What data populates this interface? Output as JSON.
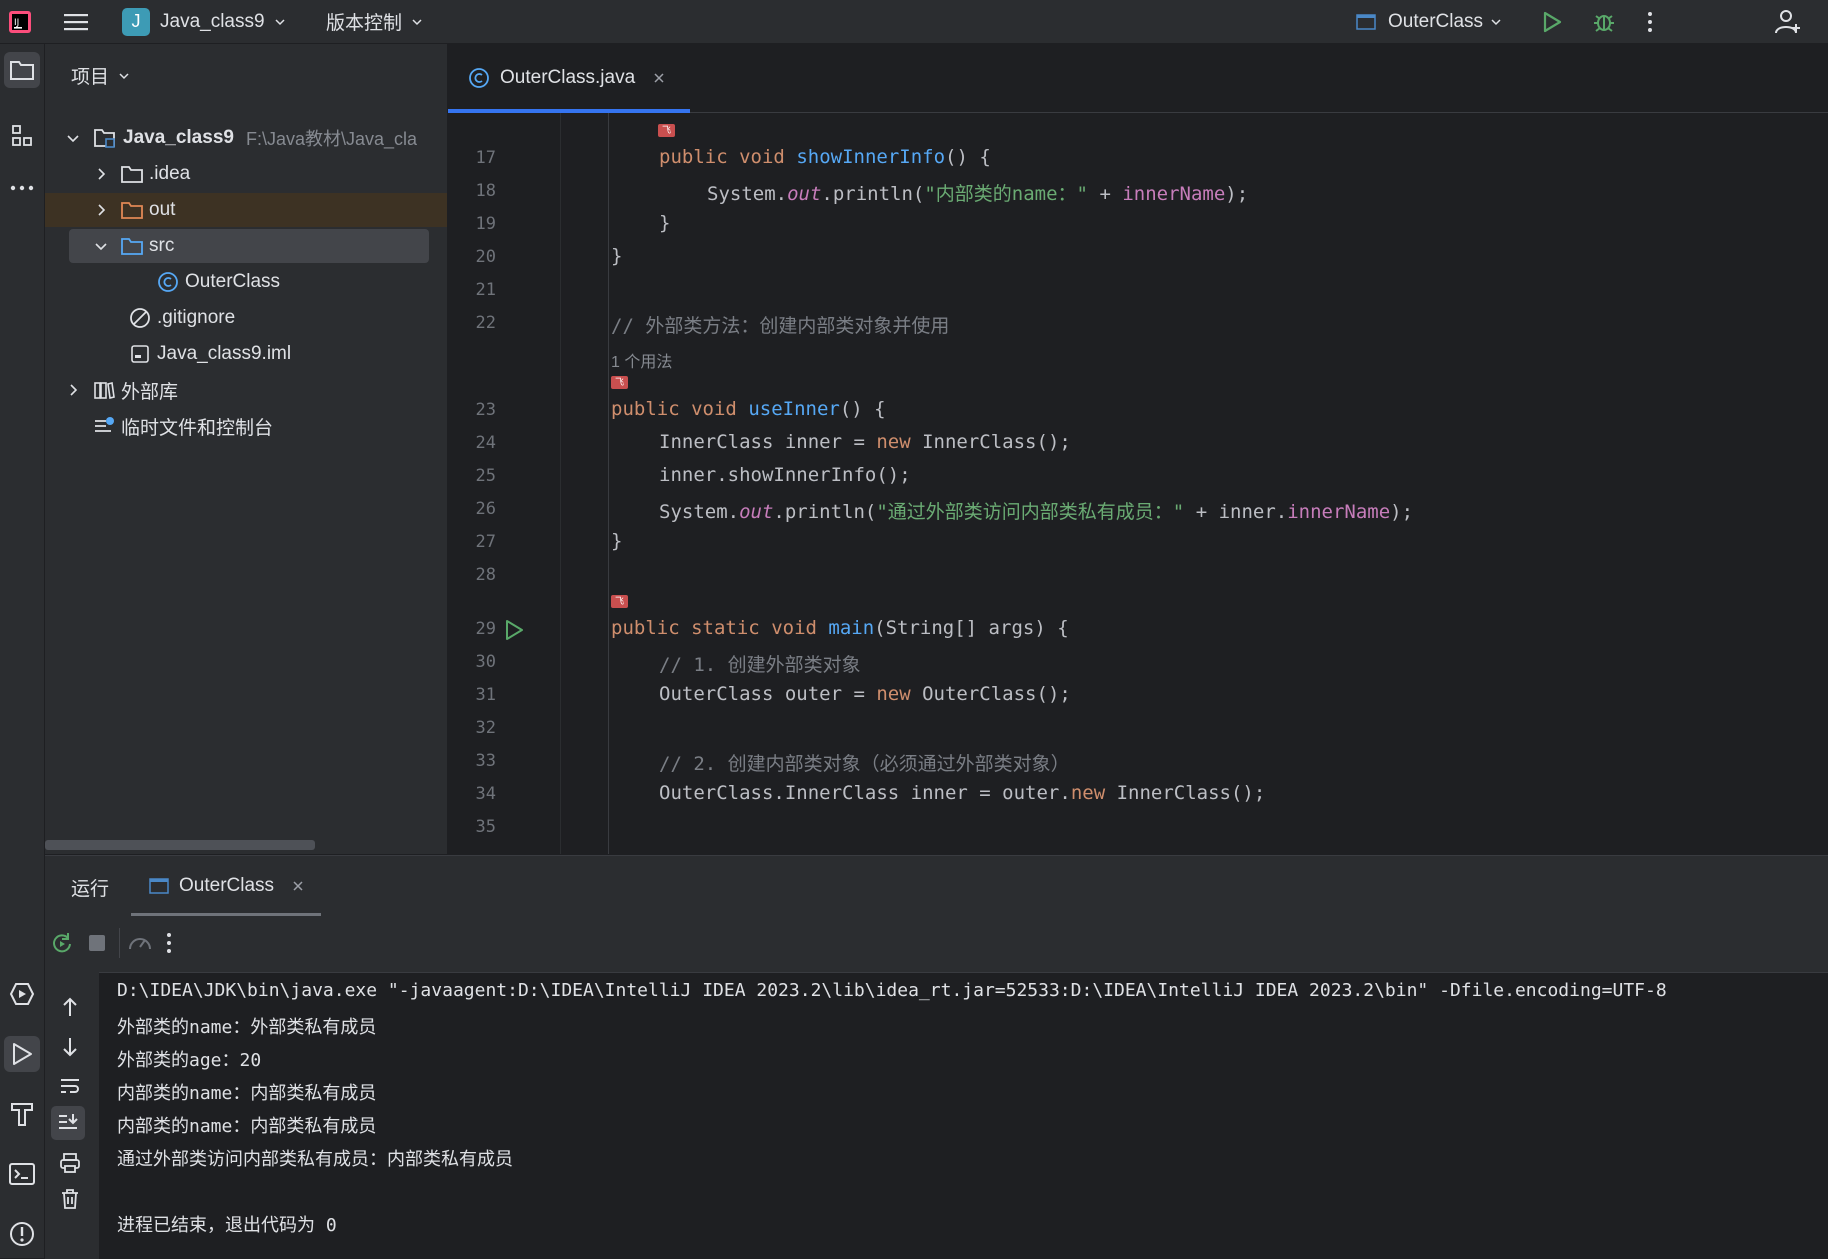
{
  "topbar": {
    "project_badge": "J",
    "project_name": "Java_class9",
    "vcs_label": "版本控制",
    "run_config": "OuterClass",
    "colors": {
      "badge": "#3d9bb5",
      "run": "#59a869",
      "debug": "#59a869"
    }
  },
  "project_panel": {
    "title": "项目",
    "tree": [
      {
        "label": "Java_class9",
        "path": "F:\\Java教材\\Java_cla",
        "icon": "module-folder-icon",
        "expanded": true
      },
      {
        "label": ".idea",
        "icon": "folder-icon"
      },
      {
        "label": "out",
        "icon": "folder-icon"
      },
      {
        "label": "src",
        "icon": "source-folder-icon",
        "expanded": true
      },
      {
        "label": "OuterClass",
        "icon": "class-icon"
      },
      {
        "label": ".gitignore",
        "icon": "ignore-file-icon"
      },
      {
        "label": "Java_class9.iml",
        "icon": "iml-file-icon"
      },
      {
        "label": "外部库",
        "icon": "library-icon"
      },
      {
        "label": "临时文件和控制台",
        "icon": "scratches-icon"
      }
    ]
  },
  "editor": {
    "tab_label": "OuterClass.java",
    "usage_hint": "1 个用法",
    "line_numbers": [
      "17",
      "18",
      "19",
      "20",
      "21",
      "22",
      "23",
      "24",
      "25",
      "26",
      "27",
      "28",
      "29",
      "30",
      "31",
      "32",
      "33",
      "34",
      "35"
    ],
    "code": {
      "l17": [
        "public",
        "void",
        "showInnerInfo",
        "() {"
      ],
      "l18": [
        "System.",
        "out",
        ".println(",
        "\"内部类的name：\"",
        " + ",
        "innerName",
        ");"
      ],
      "l19": "}",
      "l20": "}",
      "l22": "// 外部类方法：创建内部类对象并使用",
      "l23": [
        "public",
        "void",
        "useInner",
        "() {"
      ],
      "l24": [
        "InnerClass inner = ",
        "new",
        " InnerClass();"
      ],
      "l25": "inner.showInnerInfo();",
      "l26": [
        "System.",
        "out",
        ".println(",
        "\"通过外部类访问内部类私有成员：\"",
        " + inner.",
        "innerName",
        ");"
      ],
      "l27": "}",
      "l29": [
        "public",
        "static",
        "void",
        "main",
        "(String[] args) {"
      ],
      "l30": "// 1. 创建外部类对象",
      "l31": [
        "OuterClass outer = ",
        "new",
        " OuterClass();"
      ],
      "l33": "// 2. 创建内部类对象（必须通过外部类对象）",
      "l34": [
        "OuterClass.InnerClass inner = outer.",
        "new",
        " InnerClass();"
      ]
    }
  },
  "run_panel": {
    "title": "运行",
    "tab_label": "OuterClass",
    "output": [
      "D:\\IDEA\\JDK\\bin\\java.exe \"-javaagent:D:\\IDEA\\IntelliJ IDEA 2023.2\\lib\\idea_rt.jar=52533:D:\\IDEA\\IntelliJ IDEA 2023.2\\bin\" -Dfile.encoding=UTF-8",
      "外部类的name：外部类私有成员",
      "外部类的age：20",
      "内部类的name：内部类私有成员",
      "内部类的name：内部类私有成员",
      "通过外部类访问内部类私有成员：内部类私有成员",
      "",
      "进程已结束，退出代码为 0"
    ]
  }
}
